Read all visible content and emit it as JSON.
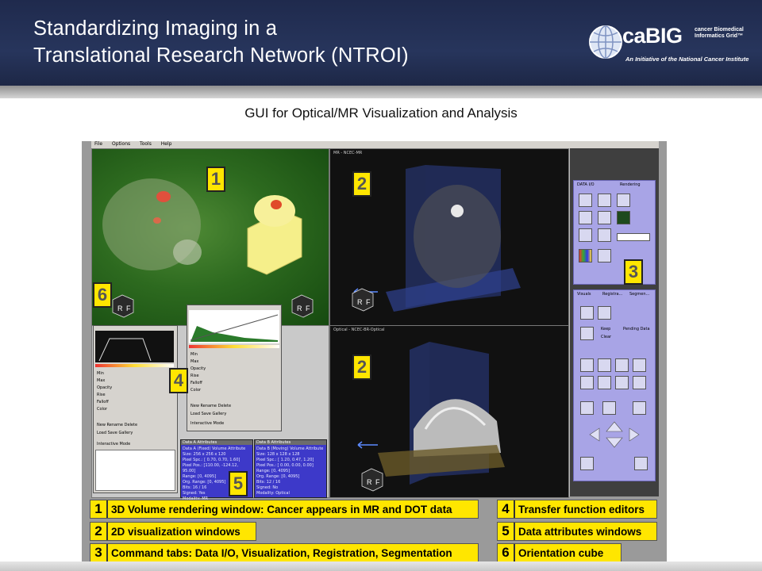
{
  "slide": {
    "title_line1": "Standardizing Imaging in a",
    "title_line2": "Translational Research Network  (NTROI)",
    "subtitle": "GUI for Optical/MR Visualization and Analysis",
    "logo": {
      "name": "caBIG",
      "tagline1": "cancer Biomedical",
      "tagline2": "Informatics Grid™",
      "initiative": "An Initiative of the National Cancer Institute"
    }
  },
  "gui": {
    "menu": [
      "File",
      "Options",
      "Tools",
      "Help"
    ],
    "panel_labels": {
      "p3d_title": "",
      "p2a_title": "MR - NCEC-MR",
      "p2b_title": "Optical - NCEC-BR-Optical"
    },
    "badges": {
      "b1": "1",
      "b2a": "2",
      "b2b": "2",
      "b3": "3",
      "b4": "4",
      "b5": "5",
      "b6": "6"
    },
    "cube_letters": {
      "r": "R",
      "f": "F"
    },
    "side_tabs_top": [
      "DATA I/O",
      "Rendering"
    ],
    "side_tabs_bottom": [
      "Visuals",
      "Registra...",
      "Segmen..."
    ],
    "side_fields": {
      "keep": "Keep",
      "clear": "Clear",
      "pending": "Pending Data"
    },
    "editor": {
      "rows": [
        "Min",
        "Max",
        "Opacity",
        "Rise",
        "Falloff",
        "Color"
      ],
      "buttons": [
        "New",
        "Rename",
        "Delete"
      ],
      "buttons2": [
        "Load",
        "Save",
        "Gallery"
      ],
      "interactive_mode": "Interactive Mode"
    },
    "attr_titles": [
      "Data A Attributes",
      "Data B Attributes"
    ],
    "attr_lines_a": [
      "Data A (Fixed) Volume Attribute",
      "Size: 256 x 256 x 120",
      "Pixel Spc.: [ 0.70, 0.70, 1.60]",
      "Pixel Pos.: [110.00, -124.12, 95.00]",
      "Range: [0, 4095]",
      "Org. Range: [0, 4095]",
      "Bits: 16 / 16",
      "Signed: Yes",
      "Modality: MR"
    ],
    "attr_lines_b": [
      "Data B (Moving) Volume Attribute",
      "Size: 128 x 128 x 128",
      "Pixel Spc.: [ 1.20, 0.47, 1.20]",
      "Pixel Pos.: [ 0.00, 0.00, 0.00]",
      "Range: [0, 4095]",
      "Org. Range: [0, 4095]",
      "Bits: 12 / 16",
      "Signed: No",
      "Modality: Optical"
    ]
  },
  "legend": [
    {
      "num": "1",
      "text": "3D Volume rendering window: Cancer appears in MR and DOT data"
    },
    {
      "num": "2",
      "text": "2D visualization windows"
    },
    {
      "num": "3",
      "text": "Command tabs: Data I/O, Visualization, Registration, Segmentation"
    },
    {
      "num": "4",
      "text": "Transfer function editors"
    },
    {
      "num": "5",
      "text": "Data attributes windows"
    },
    {
      "num": "6",
      "text": "Orientation cube"
    }
  ],
  "colors": {
    "header_bg": "#24315a",
    "badge_yellow": "#ffe600",
    "side_tab_purple": "#a8a4e6",
    "attr_blue": "#3d39c9"
  }
}
